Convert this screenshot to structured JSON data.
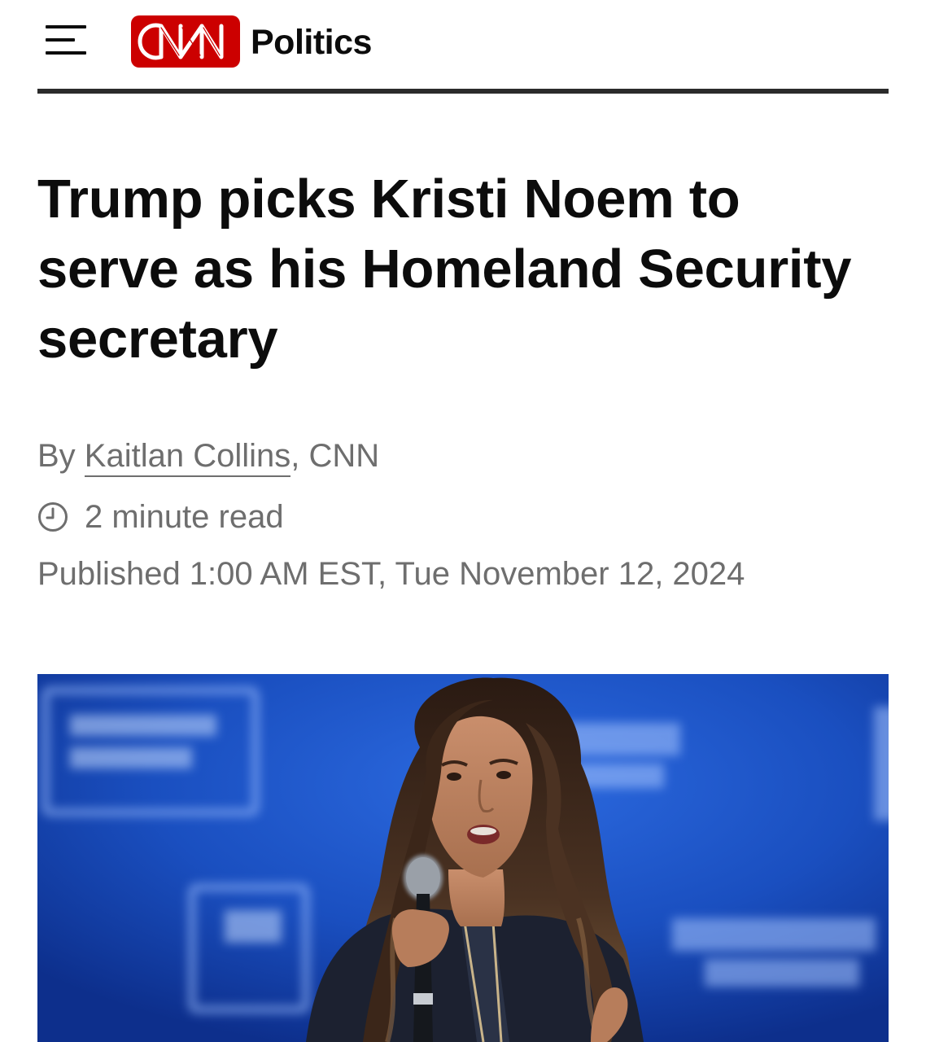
{
  "header": {
    "menu_icon": "hamburger-menu-icon",
    "brand": "CNN",
    "section": "Politics",
    "brand_color": "#cc0000"
  },
  "article": {
    "headline": "Trump picks Kristi Noem to serve as his Homeland Security secretary",
    "byline_prefix": "By ",
    "author": "Kaitlan Collins",
    "byline_suffix": ", CNN",
    "read_time_icon": "clock-icon",
    "read_time": "2 minute read",
    "published": "Published 1:00 AM EST, Tue November 12, 2024"
  },
  "lead_image": {
    "description_icon": "photo",
    "dominant_color": "#1a4fc0"
  }
}
